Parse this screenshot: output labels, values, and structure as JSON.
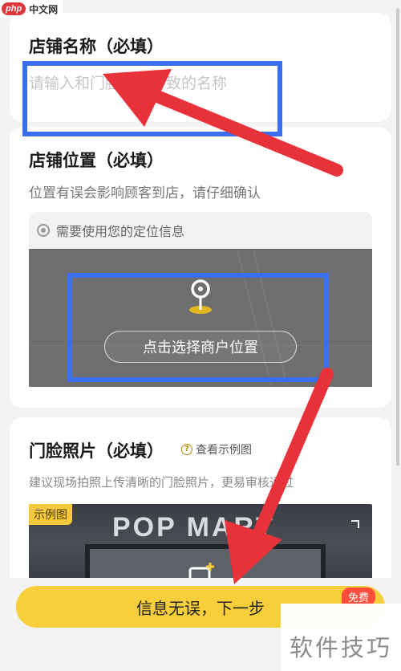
{
  "watermark": {
    "logo_badge": "php",
    "logo_text": "中文网",
    "corner_text": "软件技巧"
  },
  "store_name": {
    "title": "店铺名称（必填）",
    "placeholder": "请输入和门脸招牌一致的名称"
  },
  "store_location": {
    "title": "店铺位置（必填）",
    "subtitle": "位置有误会影响顾客到店，请仔细确认",
    "permission_text": "需要使用您的定位信息",
    "pick_button_label": "点击选择商户位置"
  },
  "storefront_photo": {
    "title": "门脸照片（必填）",
    "example_link": "查看示例图",
    "subtitle": "建议现场拍照上传清晰的门脸照片，更易审核通过",
    "sample_tag": "示例图",
    "sample_sign_text": "POP MART"
  },
  "footer": {
    "next_button_label": "信息无误，下一步",
    "badge": "免费"
  },
  "colors": {
    "accent_yellow": "#f7cf3b",
    "badge_red": "#ff4d3d",
    "highlight_blue": "#3b6df0",
    "arrow_red": "#e8323a"
  }
}
